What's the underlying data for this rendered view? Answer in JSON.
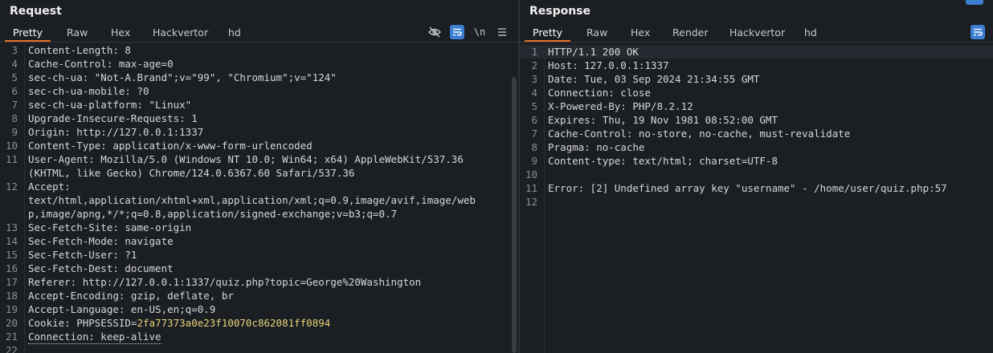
{
  "request": {
    "title": "Request",
    "tabs": [
      "Pretty",
      "Raw",
      "Hex",
      "Hackvertor",
      "hd"
    ],
    "toolbar": {
      "hide_icon": "eye-slash-icon",
      "wrap_icon": "word-wrap-icon",
      "newline_label": "\\n",
      "menu_icon": "hamburger-menu-icon"
    },
    "lines": [
      {
        "n": "3",
        "text": "Content-Length: 8"
      },
      {
        "n": "4",
        "text": "Cache-Control: max-age=0"
      },
      {
        "n": "5",
        "text": "sec-ch-ua: \"Not-A.Brand\";v=\"99\", \"Chromium\";v=\"124\""
      },
      {
        "n": "6",
        "text": "sec-ch-ua-mobile: ?0"
      },
      {
        "n": "7",
        "text": "sec-ch-ua-platform: \"Linux\""
      },
      {
        "n": "8",
        "text": "Upgrade-Insecure-Requests: 1"
      },
      {
        "n": "9",
        "text": "Origin: http://127.0.0.1:1337"
      },
      {
        "n": "10",
        "text": "Content-Type: application/x-www-form-urlencoded"
      },
      {
        "n": "11",
        "text": "User-Agent: Mozilla/5.0 (Windows NT 10.0; Win64; x64) AppleWebKit/537.36"
      },
      {
        "n": "",
        "text": "(KHTML, like Gecko) Chrome/124.0.6367.60 Safari/537.36"
      },
      {
        "n": "12",
        "text": "Accept:"
      },
      {
        "n": "",
        "text": "text/html,application/xhtml+xml,application/xml;q=0.9,image/avif,image/web"
      },
      {
        "n": "",
        "text": "p,image/apng,*/*;q=0.8,application/signed-exchange;v=b3;q=0.7"
      },
      {
        "n": "13",
        "text": "Sec-Fetch-Site: same-origin"
      },
      {
        "n": "14",
        "text": "Sec-Fetch-Mode: navigate"
      },
      {
        "n": "15",
        "text": "Sec-Fetch-User: ?1"
      },
      {
        "n": "16",
        "text": "Sec-Fetch-Dest: document"
      },
      {
        "n": "17",
        "text": "Referer: http://127.0.0.1:1337/quiz.php?topic=George%20Washington"
      },
      {
        "n": "18",
        "text": "Accept-Encoding: gzip, deflate, br"
      },
      {
        "n": "19",
        "text": "Accept-Language: en-US,en;q=0.9"
      }
    ],
    "cookie": {
      "n": "20",
      "prefix": "Cookie: PHPSESSID=",
      "value": "2fa77373a0e23f10070c862081ff0894"
    },
    "connection": {
      "n": "21",
      "text": "Connection: keep-alive"
    },
    "last_line": {
      "n": "22",
      "text": ""
    }
  },
  "response": {
    "title": "Response",
    "tabs": [
      "Pretty",
      "Raw",
      "Hex",
      "Render",
      "Hackvertor",
      "hd"
    ],
    "toolbar": {
      "wrap_icon": "word-wrap-icon"
    },
    "lines": [
      {
        "n": "1",
        "text": "HTTP/1.1 200 OK"
      },
      {
        "n": "2",
        "text": "Host: 127.0.0.1:1337"
      },
      {
        "n": "3",
        "text": "Date: Tue, 03 Sep 2024 21:34:55 GMT"
      },
      {
        "n": "4",
        "text": "Connection: close"
      },
      {
        "n": "5",
        "text": "X-Powered-By: PHP/8.2.12"
      },
      {
        "n": "6",
        "text": "Expires: Thu, 19 Nov 1981 08:52:00 GMT"
      },
      {
        "n": "7",
        "text": "Cache-Control: no-store, no-cache, must-revalidate"
      },
      {
        "n": "8",
        "text": "Pragma: no-cache"
      },
      {
        "n": "9",
        "text": "Content-type: text/html; charset=UTF-8"
      },
      {
        "n": "10",
        "text": ""
      },
      {
        "n": "11",
        "text": "Error: [2] Undefined array key \"username\" - /home/user/quiz.php:57"
      },
      {
        "n": "12",
        "text": ""
      }
    ]
  }
}
